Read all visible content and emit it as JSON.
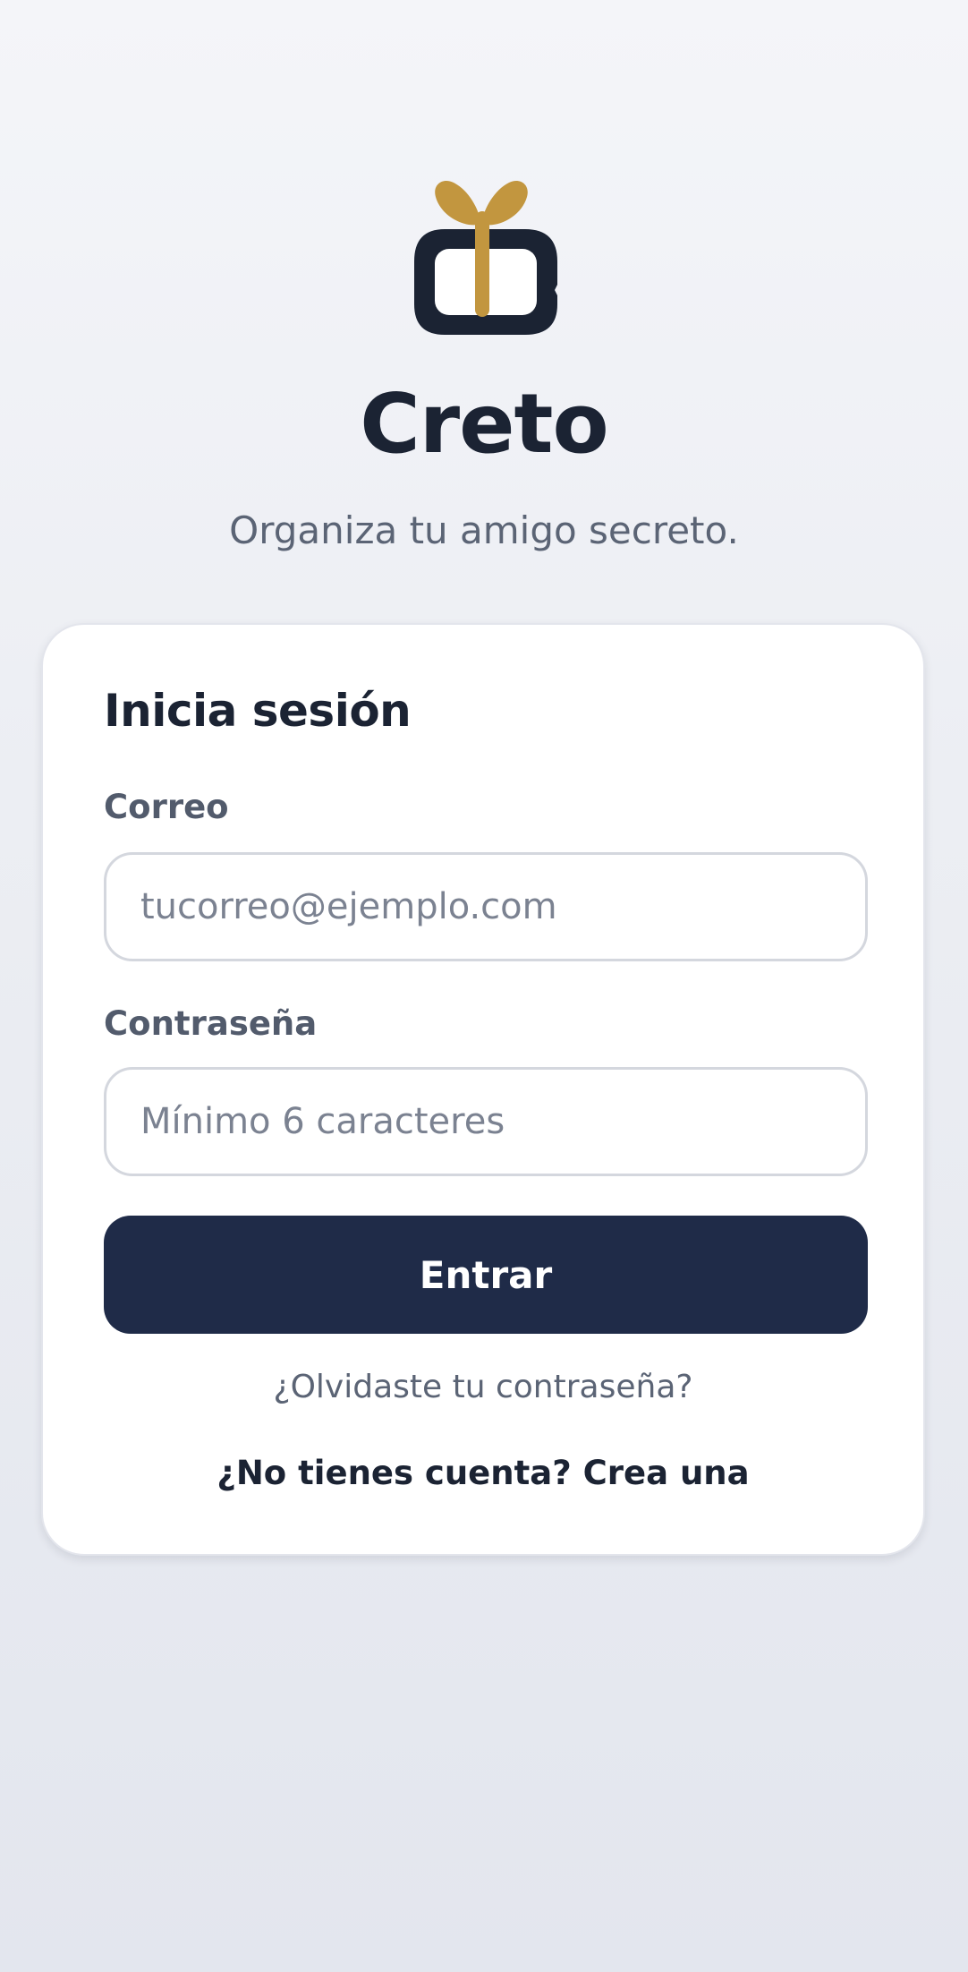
{
  "app": {
    "title": "Creto",
    "tagline": "Organiza tu amigo secreto.",
    "logo_icon": "gift-icon",
    "colors": {
      "primary": "#1f2b48",
      "accent": "#c2963f",
      "text_dark": "#1b2333",
      "text_muted": "#5b6475"
    }
  },
  "login": {
    "heading": "Inicia sesión",
    "email": {
      "label": "Correo",
      "placeholder": "tucorreo@ejemplo.com",
      "value": ""
    },
    "password": {
      "label": "Contraseña",
      "placeholder": "Mínimo 6 caracteres",
      "value": ""
    },
    "submit_label": "Entrar",
    "forgot_link": "¿Olvidaste tu contraseña?",
    "signup_link": "¿No tienes cuenta? Crea una"
  }
}
